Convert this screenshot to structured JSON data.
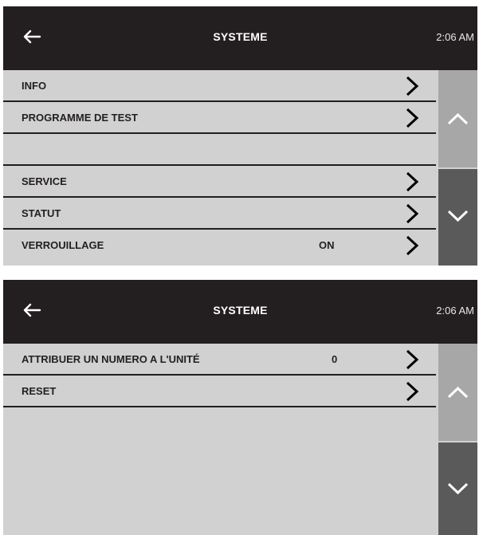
{
  "screens": [
    {
      "title": "SYSTEME",
      "time": "2:06 AM",
      "rows": [
        {
          "label": "INFO",
          "value": "",
          "chevron": true
        },
        {
          "label": "PROGRAMME DE TEST",
          "value": "",
          "chevron": true
        },
        {
          "label": "",
          "value": "",
          "chevron": false
        },
        {
          "label": "SERVICE",
          "value": "",
          "chevron": true
        },
        {
          "label": "STATUT",
          "value": "",
          "chevron": true
        },
        {
          "label": "VERROUILLAGE",
          "value": "ON",
          "chevron": true
        }
      ]
    },
    {
      "title": "SYSTEME",
      "time": "2:06 AM",
      "rows": [
        {
          "label": "ATTRIBUER UN NUMERO A L'UNITÉ",
          "value": "0",
          "chevron": true
        },
        {
          "label": "RESET",
          "value": "",
          "chevron": true
        }
      ]
    }
  ],
  "icons": {
    "back": "arrow-left-icon",
    "row_chevron": "chevron-right-icon",
    "scroll_up": "chevron-up-icon",
    "scroll_down": "chevron-down-icon"
  },
  "colors": {
    "header_bg": "#231f20",
    "panel_bg": "#d1d1d1",
    "scroll_up_bg": "#a7a7a7",
    "scroll_down_bg": "#5a5a5a"
  }
}
